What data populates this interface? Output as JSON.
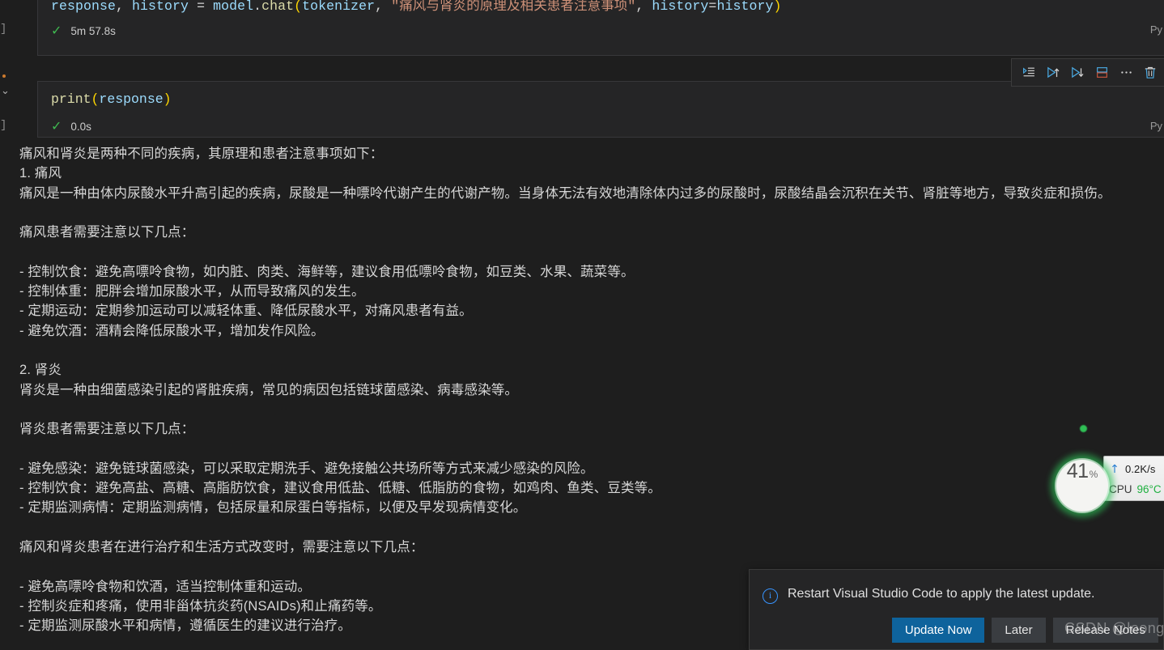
{
  "theme": {
    "editor_bg": "#1e1e1e",
    "cell_bg": "#252526",
    "cell_border": "#37373a",
    "text": "#d6d6d6",
    "accent_blue": "#0e639c",
    "success_green": "#3fb950",
    "string_orange": "#ce9178"
  },
  "notebook": {
    "cells": [
      {
        "execution_bracket": "]",
        "language": "Py",
        "code_tokens": [
          {
            "t": "response",
            "c": "tok-var"
          },
          {
            "t": ", ",
            "c": "tok-plain"
          },
          {
            "t": "history",
            "c": "tok-var"
          },
          {
            "t": " ",
            "c": "tok-plain"
          },
          {
            "t": "=",
            "c": "tok-op"
          },
          {
            "t": " ",
            "c": "tok-plain"
          },
          {
            "t": "model",
            "c": "tok-var"
          },
          {
            "t": ".",
            "c": "tok-plain"
          },
          {
            "t": "chat",
            "c": "tok-fn"
          },
          {
            "t": "(",
            "c": "tok-p1"
          },
          {
            "t": "tokenizer",
            "c": "tok-var"
          },
          {
            "t": ", ",
            "c": "tok-plain"
          },
          {
            "t": "\"痛风与肾炎的原理及相关患者注意事项\"",
            "c": "tok-str"
          },
          {
            "t": ", ",
            "c": "tok-plain"
          },
          {
            "t": "history",
            "c": "tok-var"
          },
          {
            "t": "=",
            "c": "tok-op"
          },
          {
            "t": "history",
            "c": "tok-var"
          },
          {
            "t": ")",
            "c": "tok-p1"
          }
        ],
        "status_icon": "check-icon",
        "status_time": "5m 57.8s"
      },
      {
        "execution_bracket": "]",
        "language": "Py",
        "collapse_icon": "chevron-down-icon",
        "code_tokens": [
          {
            "t": "print",
            "c": "tok-fn"
          },
          {
            "t": "(",
            "c": "tok-p1"
          },
          {
            "t": "response",
            "c": "tok-var"
          },
          {
            "t": ")",
            "c": "tok-p1"
          }
        ],
        "status_icon": "check-icon",
        "status_time": "0.0s"
      }
    ],
    "toolbar": {
      "buttons": [
        {
          "name": "execute-above-icon",
          "label": "Execute Above Cells"
        },
        {
          "name": "run-above-icon",
          "label": "Run Above"
        },
        {
          "name": "run-below-icon",
          "label": "Run Below"
        },
        {
          "name": "split-cell-icon",
          "label": "Split Cell"
        },
        {
          "name": "more-actions-icon",
          "label": "More Actions..."
        },
        {
          "name": "delete-cell-icon",
          "label": "Delete Cell"
        }
      ]
    },
    "output_lines": [
      "痛风和肾炎是两种不同的疾病，其原理和患者注意事项如下：",
      "1. 痛风",
      "痛风是一种由体内尿酸水平升高引起的疾病，尿酸是一种嘌呤代谢产生的代谢产物。当身体无法有效地清除体内过多的尿酸时，尿酸结晶会沉积在关节、肾脏等地方，导致炎症和损伤。",
      "",
      "痛风患者需要注意以下几点：",
      "",
      "- 控制饮食：避免高嘌呤食物，如内脏、肉类、海鲜等，建议食用低嘌呤食物，如豆类、水果、蔬菜等。",
      "- 控制体重：肥胖会增加尿酸水平，从而导致痛风的发生。",
      "- 定期运动：定期参加运动可以减轻体重、降低尿酸水平，对痛风患者有益。",
      "- 避免饮酒：酒精会降低尿酸水平，增加发作风险。",
      "",
      "2. 肾炎",
      "肾炎是一种由细菌感染引起的肾脏疾病，常见的病因包括链球菌感染、病毒感染等。",
      "",
      "肾炎患者需要注意以下几点：",
      "",
      "- 避免感染：避免链球菌感染，可以采取定期洗手、避免接触公共场所等方式来减少感染的风险。",
      "- 控制饮食：避免高盐、高糖、高脂肪饮食，建议食用低盐、低糖、低脂肪的食物，如鸡肉、鱼类、豆类等。",
      "- 定期监测病情：定期监测病情，包括尿量和尿蛋白等指标，以便及早发现病情变化。",
      "",
      "痛风和肾炎患者在进行治疗和生活方式改变时，需要注意以下几点：",
      "",
      "- 避免高嘌呤食物和饮酒，适当控制体重和运动。",
      "- 控制炎症和疼痛，使用非甾体抗炎药(NSAIDs)和止痛药等。",
      "- 定期监测尿酸水平和病情，遵循医生的建议进行治疗。"
    ]
  },
  "perf_widget": {
    "cpu_usage_value": "41",
    "cpu_usage_unit": "%",
    "network_up_icon": "arrow-up-icon",
    "network_up_rate": "0.2K/s",
    "cpu_label": "CPU",
    "cpu_temp": "96°C",
    "ring_color": "#2dbe55"
  },
  "notification": {
    "icon": "info-icon",
    "message": "Restart Visual Studio Code to apply the latest update.",
    "buttons": [
      {
        "label": "Update Now",
        "style": "primary"
      },
      {
        "label": "Later",
        "style": "secondary"
      },
      {
        "label": "Release Notes",
        "style": "secondary"
      }
    ]
  },
  "watermark": {
    "text": "CSDN @loong_XL"
  }
}
